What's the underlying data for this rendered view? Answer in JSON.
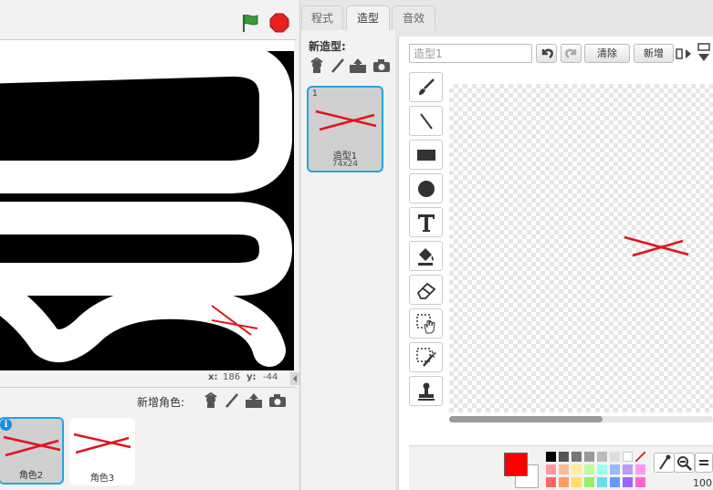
{
  "stage": {
    "coords": {
      "x_label": "x:",
      "x_value": "186",
      "y_label": "y:",
      "y_value": "-44"
    }
  },
  "sprites": {
    "new_sprite_label": "新增角色:",
    "items": [
      {
        "label": "角色2",
        "selected": true
      },
      {
        "label": "角色3",
        "selected": false
      }
    ]
  },
  "tabs": [
    {
      "label": "程式",
      "active": false
    },
    {
      "label": "造型",
      "active": true
    },
    {
      "label": "音效",
      "active": false
    }
  ],
  "costumes": {
    "new_costume_label": "新造型:",
    "items": [
      {
        "index": "1",
        "name": "造型1",
        "size": "74x24"
      }
    ]
  },
  "editor": {
    "costume_name": "造型1",
    "clear_label": "清除",
    "add_label": "新增",
    "zoom_label": "100",
    "primary_color": "#ff0000"
  },
  "colors": {
    "accent": "#29a3e0",
    "flag": "#2e8b2e",
    "stop": "#e8201e",
    "stroke": "#e0141e"
  }
}
